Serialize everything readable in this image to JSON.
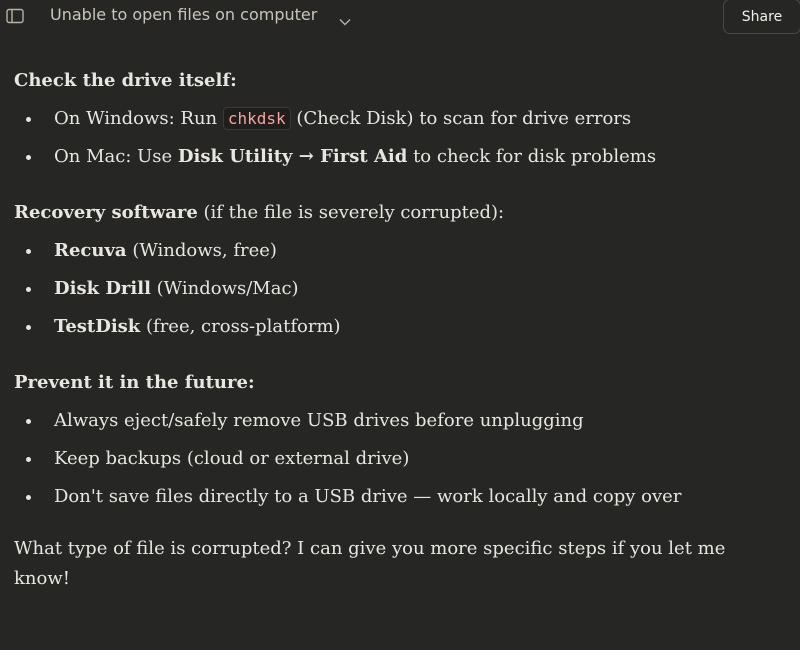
{
  "header": {
    "chat_title": "Unable to open files on computer",
    "share_label": "Share"
  },
  "icons": {
    "sidebar": "sidebar-panel-icon",
    "chevron": "chevron-down-icon"
  },
  "colors": {
    "background": "#262624",
    "text": "#e8e6e0",
    "code": "#f2a4a4"
  },
  "message": {
    "section1": {
      "heading": "Check the drive itself:",
      "item1": {
        "prefix": "On Windows: Run ",
        "code": "chkdsk",
        "suffix": " (Check Disk) to scan for drive errors"
      },
      "item2": {
        "prefix": "On Mac: Use ",
        "bold": "Disk Utility → First Aid",
        "suffix": " to check for disk problems"
      }
    },
    "section2": {
      "heading_bold": "Recovery software",
      "heading_rest": " (if the file is severely corrupted):",
      "items": [
        {
          "bold": "Recuva",
          "rest": " (Windows, free)"
        },
        {
          "bold": "Disk Drill",
          "rest": " (Windows/Mac)"
        },
        {
          "bold": "TestDisk",
          "rest": " (free, cross-platform)"
        }
      ]
    },
    "section3": {
      "heading": "Prevent it in the future:",
      "items": [
        "Always eject/safely remove USB drives before unplugging",
        "Keep backups (cloud or external drive)",
        "Don't save files directly to a USB drive — work locally and copy over"
      ]
    },
    "closing": "What type of file is corrupted? I can give you more specific steps if you let me know!"
  }
}
